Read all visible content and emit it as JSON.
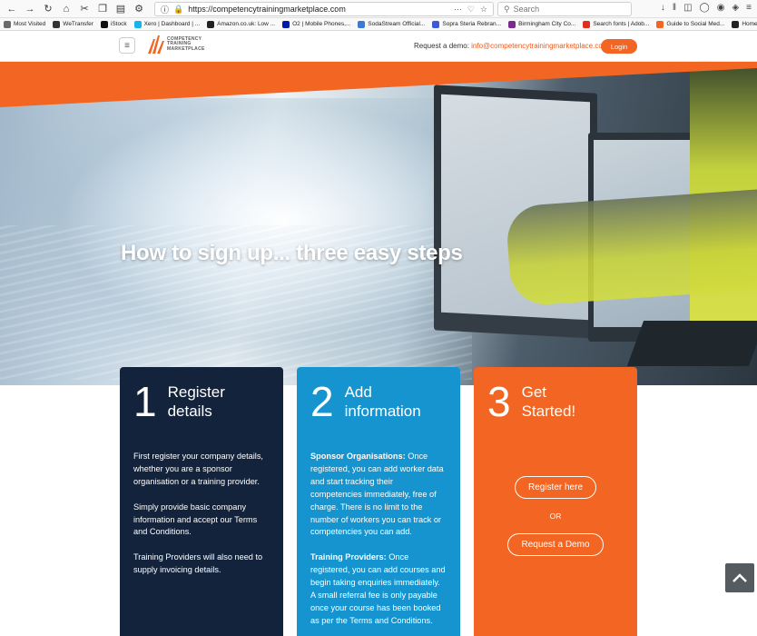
{
  "browser": {
    "url": "https://competencytrainingmarketplace.com",
    "search_placeholder": "Search",
    "bookmarks": [
      {
        "label": "Most Visited",
        "color": "#6b6b6b"
      },
      {
        "label": "WeTransfer",
        "color": "#333333"
      },
      {
        "label": "iStock",
        "color": "#111111"
      },
      {
        "label": "Xero | Dashboard | ...",
        "color": "#13b5ea"
      },
      {
        "label": "Amazon.co.uk: Low ...",
        "color": "#222222"
      },
      {
        "label": "O2 | Mobile Phones,...",
        "color": "#0019a5"
      },
      {
        "label": "SodaStream Official...",
        "color": "#3a7bd5"
      },
      {
        "label": "Sopra Steria Rebran...",
        "color": "#3a5bd5"
      },
      {
        "label": "Birmingham City Co...",
        "color": "#7b2a8f"
      },
      {
        "label": "Search fonts | Adob...",
        "color": "#e32c1b"
      },
      {
        "label": "Guide to Social Med...",
        "color": "#f26522"
      },
      {
        "label": "Home of Mauve Des...",
        "color": "#222222"
      }
    ]
  },
  "header": {
    "logo_lines": [
      "COMPETENCY",
      "TRAINING",
      "MARKETPLACE"
    ],
    "demo_prefix": "Request a demo: ",
    "demo_email": "info@competencytrainingmarketplace.com",
    "login_label": "Login"
  },
  "hero": {
    "title": "How to sign up... three easy steps"
  },
  "cards": [
    {
      "number": "1",
      "title_line1": "Register",
      "title_line2": "details",
      "paragraphs": [
        "First register your company details, whether you are a sponsor organisation or a training provider.",
        "Simply provide basic company information and accept our Terms and Conditions.",
        "Training Providers will also need to supply invoicing details."
      ]
    },
    {
      "number": "2",
      "title_line1": "Add",
      "title_line2": "information",
      "sections": [
        {
          "heading": "Sponsor Organisations:",
          "text": " Once registered, you can add worker data and start tracking their competencies immediately, free of charge. There is no limit to the number of workers you can track or competencies you can add."
        },
        {
          "heading": "Training Providers:",
          "text": " Once registered, you can add courses and begin taking enquiries immediately. A small referral fee is only payable once your course has been booked as per the Terms and Conditions."
        }
      ]
    },
    {
      "number": "3",
      "title_line1": "Get",
      "title_line2": "Started!",
      "register_label": "Register here",
      "or_label": "OR",
      "demo_label": "Request a Demo"
    }
  ],
  "colors": {
    "brand_orange": "#f26522",
    "navy": "#13233c",
    "blue": "#1594cf"
  }
}
